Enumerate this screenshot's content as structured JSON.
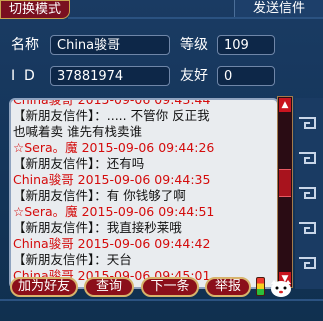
{
  "header": {
    "left_tab": "切换模式",
    "right_tab": "发送信件",
    "close_glyph": "×"
  },
  "profile": {
    "name_label": "名称",
    "name_value": "China骏哥",
    "level_label": "等级",
    "level_value": "109",
    "id_label": "I  D",
    "id_value": "37881974",
    "friend_label": "友好",
    "friend_value": "0"
  },
  "chat": {
    "lines": [
      {
        "kind": "hdr",
        "text": "China骏哥  2015-09-06 09:43:44"
      },
      {
        "kind": "sys",
        "text": "【新朋友信件】：.....  不管你  反正我"
      },
      {
        "kind": "sys",
        "text": "也喊着卖  谁先有栈卖谁"
      },
      {
        "kind": "hdr",
        "text": "☆Sera。魔 2015-09-06 09:44:26"
      },
      {
        "kind": "sys",
        "text": "【新朋友信件】：还有吗"
      },
      {
        "kind": "hdr",
        "text": "China骏哥 2015-09-06 09:44:35"
      },
      {
        "kind": "sys",
        "text": "【新朋友信件】：有 你钱够了啊"
      },
      {
        "kind": "hdr",
        "text": "☆Sera。魔 2015-09-06 09:44:51"
      },
      {
        "kind": "sys",
        "text": "【新朋友信件】：我直接秒莱哦"
      },
      {
        "kind": "hdr",
        "text": "China骏哥 2015-09-06 09:44:42"
      },
      {
        "kind": "sys",
        "text": "【新朋友信件】：天台"
      },
      {
        "kind": "hdr",
        "text": "China骏哥  2015-09-06 09:45:01"
      }
    ]
  },
  "buttons": {
    "add_friend": "加为好友",
    "query": "查询",
    "next": "下一条",
    "report": "举报"
  },
  "colors": {
    "accent_red": "#8b0f1a",
    "gold_border": "#d7b36b",
    "message_header": "#d40c0c"
  }
}
